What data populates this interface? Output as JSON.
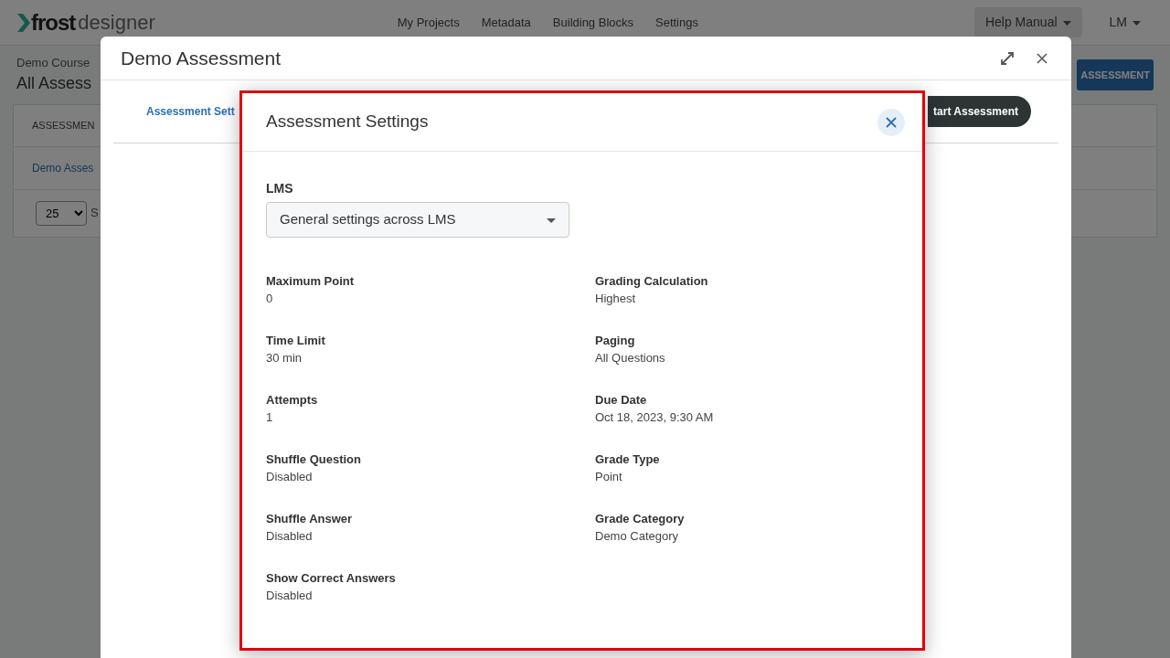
{
  "app": {
    "logo": {
      "primary": "frost",
      "secondary": "designer"
    },
    "nav": [
      "My Projects",
      "Metadata",
      "Building Blocks",
      "Settings"
    ],
    "help_menu": "Help Manual",
    "user_menu": "LM",
    "breadcrumb": "Demo Course",
    "page_title": "All Assess",
    "add_button": "ASSESSMENT",
    "table": {
      "column_1": "ASSESSMEN",
      "rows": [
        "Demo Asses"
      ]
    },
    "page_size": "25",
    "page_size_label": "S"
  },
  "modal": {
    "title": "Demo Assessment",
    "tabs": [
      {
        "label": "Assessment Sett",
        "selected": true
      }
    ],
    "start_button": "tart Assessment"
  },
  "dialog": {
    "title": "Assessment Settings",
    "lms_label": "LMS",
    "lms_value": "General settings across LMS",
    "fields": [
      {
        "label": "Maximum Point",
        "value": "0"
      },
      {
        "label": "Grading Calculation",
        "value": "Highest"
      },
      {
        "label": "Time Limit",
        "value": "30 min"
      },
      {
        "label": "Paging",
        "value": "All Questions"
      },
      {
        "label": "Attempts",
        "value": "1"
      },
      {
        "label": "Due Date",
        "value": "Oct 18, 2023, 9:30 AM"
      },
      {
        "label": "Shuffle Question",
        "value": "Disabled"
      },
      {
        "label": "Grade Type",
        "value": "Point"
      },
      {
        "label": "Shuffle Answer",
        "value": "Disabled"
      },
      {
        "label": "Grade Category",
        "value": "Demo Category"
      },
      {
        "label": "Show Correct Answers",
        "value": "Disabled"
      }
    ]
  }
}
